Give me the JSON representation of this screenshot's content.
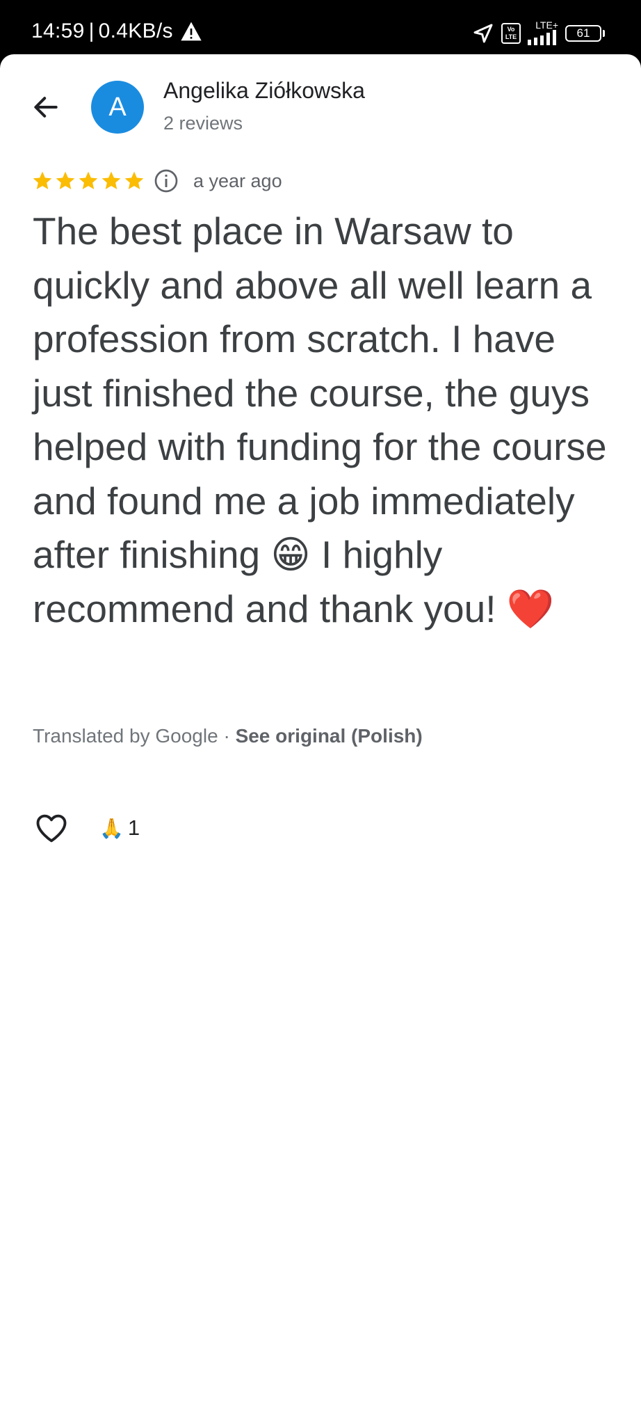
{
  "status_bar": {
    "time": "14:59",
    "separator": "|",
    "network_speed": "0.4KB/s",
    "volte_label": "Vo LTE",
    "network_type": "LTE+",
    "battery_level": "61",
    "icons": [
      "warning-icon",
      "location-arrow-icon",
      "volte-icon",
      "signal-icon",
      "battery-icon"
    ]
  },
  "header": {
    "back_icon": "arrow-left-icon",
    "avatar_initial": "A",
    "avatar_color": "#1a8ce0",
    "reviewer_name": "Angelika Ziółkowska",
    "review_count": "2 reviews"
  },
  "review": {
    "rating": 5,
    "max_rating": 5,
    "star_color": "#fbbc04",
    "date": "a year ago",
    "text": "The best place in Warsaw to quickly and above all well learn a profession from scratch. I have just finished the course, the guys helped with funding for the course and found me a job immediately after finishing 😁 I highly recommend and thank you! ❤️",
    "translated_by": "Translated by Google",
    "dot_separator": "·",
    "see_original": "See original (Polish)"
  },
  "actions": {
    "like_icon": "heart-outline-icon",
    "reaction_emoji": "🙏",
    "reaction_count": "1"
  }
}
